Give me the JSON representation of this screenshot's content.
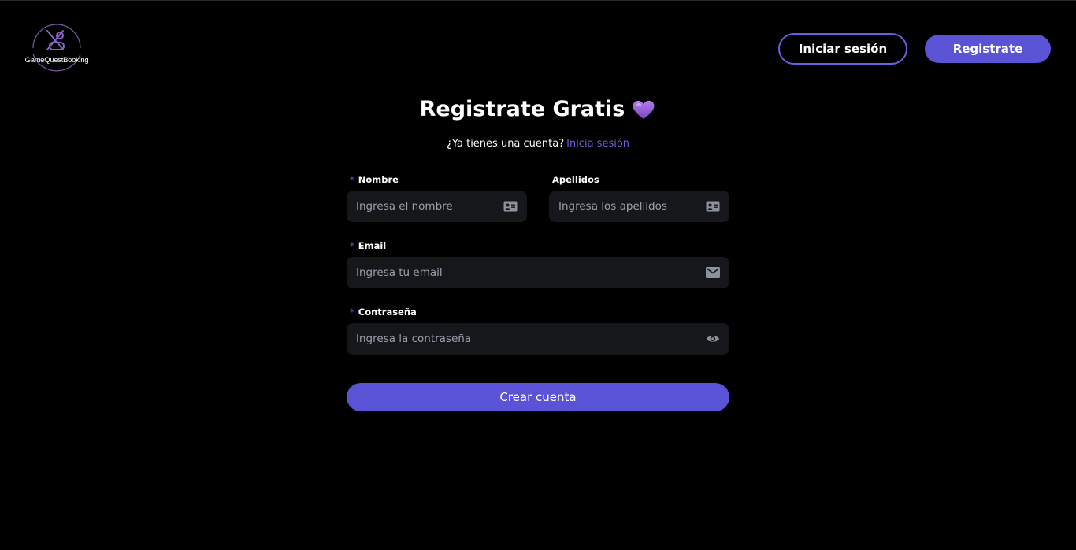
{
  "brand": {
    "name": "GameQuestBooking"
  },
  "header": {
    "login_label": "Iniciar sesión",
    "register_label": "Registrate"
  },
  "title": {
    "text": "Registrate Gratis",
    "emoji": "purple-heart-icon"
  },
  "subtitle": {
    "question": "¿Ya tienes una cuenta?",
    "link": "Inicia sesión"
  },
  "form": {
    "required_marker": "*",
    "nombre": {
      "label": "Nombre",
      "placeholder": "Ingresa el nombre",
      "value": "",
      "icon": "id-card-icon",
      "required": true
    },
    "apellidos": {
      "label": "Apellidos",
      "placeholder": "Ingresa los apellidos",
      "value": "",
      "icon": "id-card-icon",
      "required": false
    },
    "email": {
      "label": "Email",
      "placeholder": "Ingresa tu email",
      "value": "",
      "icon": "mail-icon",
      "required": true
    },
    "password": {
      "label": "Contraseña",
      "placeholder": "Ingresa la contraseña",
      "value": "",
      "icon": "eye-icon",
      "required": true
    },
    "submit_label": "Crear cuenta"
  },
  "colors": {
    "background": "#000000",
    "accent": "#5b53d6",
    "accent_border": "#6a5ee0",
    "input_bg": "#16171a",
    "placeholder": "#9aa1ab"
  }
}
